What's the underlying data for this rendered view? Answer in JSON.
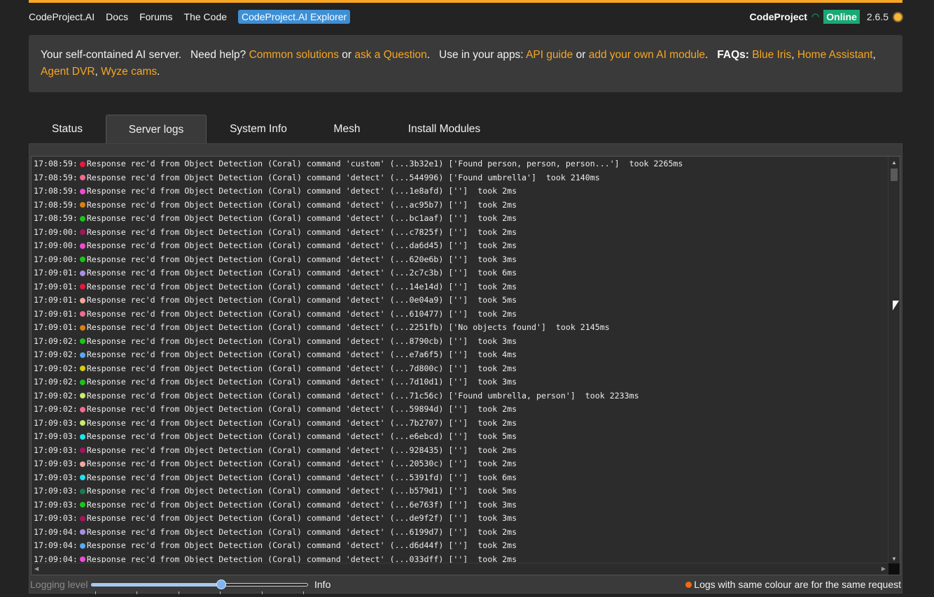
{
  "nav": {
    "items": [
      "CodeProject.AI",
      "Docs",
      "Forums",
      "The Code"
    ],
    "explorer": "CodeProject.AI Explorer"
  },
  "brand": {
    "name": "CodeProject",
    "status": "Online",
    "version": "2.6.5",
    "status_color": "#19a974",
    "accent": "#f6a623"
  },
  "banner": {
    "t1": "Your self-contained AI server.",
    "t2": "Need help?",
    "link_solutions": "Common solutions",
    "or1": "or",
    "link_ask": "ask a Question",
    "t3": "Use in your apps:",
    "link_api": "API guide",
    "or2": "or",
    "link_module": "add your own AI module",
    "faqs": "FAQs:",
    "link_blueiris": "Blue Iris",
    "link_ha": "Home Assistant",
    "link_agent": "Agent DVR",
    "link_wyze": "Wyze cams"
  },
  "tabs": [
    "Status",
    "Server logs",
    "System Info",
    "Mesh",
    "Install Modules"
  ],
  "active_tab": "Server logs",
  "logs": [
    {
      "time": "17:08:59:",
      "color": "#e8173f",
      "text": "Response rec'd from Object Detection (Coral) command 'custom' (...3b32e1) ['Found person, person, person...']  took 2265ms"
    },
    {
      "time": "17:08:59:",
      "color": "#f26a8d",
      "text": "Response rec'd from Object Detection (Coral) command 'detect' (...544996) ['Found umbrella']  took 2140ms"
    },
    {
      "time": "17:08:59:",
      "color": "#ee4bd4",
      "text": "Response rec'd from Object Detection (Coral) command 'detect' (...1e8afd) ['']  took 2ms"
    },
    {
      "time": "17:08:59:",
      "color": "#d9800f",
      "text": "Response rec'd from Object Detection (Coral) command 'detect' (...ac95b7) ['']  took 2ms"
    },
    {
      "time": "17:08:59:",
      "color": "#1bc41b",
      "text": "Response rec'd from Object Detection (Coral) command 'detect' (...bc1aaf) ['']  took 2ms"
    },
    {
      "time": "17:09:00:",
      "color": "#a3165c",
      "text": "Response rec'd from Object Detection (Coral) command 'detect' (...c7825f) ['']  took 2ms"
    },
    {
      "time": "17:09:00:",
      "color": "#ee4bd4",
      "text": "Response rec'd from Object Detection (Coral) command 'detect' (...da6d45) ['']  took 2ms"
    },
    {
      "time": "17:09:00:",
      "color": "#1bc41b",
      "text": "Response rec'd from Object Detection (Coral) command 'detect' (...620e6b) ['']  took 3ms"
    },
    {
      "time": "17:09:01:",
      "color": "#a98ee6",
      "text": "Response rec'd from Object Detection (Coral) command 'detect' (...2c7c3b) ['']  took 6ms"
    },
    {
      "time": "17:09:01:",
      "color": "#e8173f",
      "text": "Response rec'd from Object Detection (Coral) command 'detect' (...14e14d) ['']  took 2ms"
    },
    {
      "time": "17:09:01:",
      "color": "#f0a79a",
      "text": "Response rec'd from Object Detection (Coral) command 'detect' (...0e04a9) ['']  took 5ms"
    },
    {
      "time": "17:09:01:",
      "color": "#f26a8d",
      "text": "Response rec'd from Object Detection (Coral) command 'detect' (...610477) ['']  took 2ms"
    },
    {
      "time": "17:09:01:",
      "color": "#d9800f",
      "text": "Response rec'd from Object Detection (Coral) command 'detect' (...2251fb) ['No objects found']  took 2145ms"
    },
    {
      "time": "17:09:02:",
      "color": "#1bc41b",
      "text": "Response rec'd from Object Detection (Coral) command 'detect' (...8790cb) ['']  took 3ms"
    },
    {
      "time": "17:09:02:",
      "color": "#57a9f2",
      "text": "Response rec'd from Object Detection (Coral) command 'detect' (...e7a6f5) ['']  took 4ms"
    },
    {
      "time": "17:09:02:",
      "color": "#d8cc10",
      "text": "Response rec'd from Object Detection (Coral) command 'detect' (...7d800c) ['']  took 2ms"
    },
    {
      "time": "17:09:02:",
      "color": "#1bc41b",
      "text": "Response rec'd from Object Detection (Coral) command 'detect' (...7d10d1) ['']  took 3ms"
    },
    {
      "time": "17:09:02:",
      "color": "#c8ea6e",
      "text": "Response rec'd from Object Detection (Coral) command 'detect' (...71c56c) ['Found umbrella, person']  took 2233ms"
    },
    {
      "time": "17:09:02:",
      "color": "#f26a8d",
      "text": "Response rec'd from Object Detection (Coral) command 'detect' (...59894d) ['']  took 2ms"
    },
    {
      "time": "17:09:03:",
      "color": "#c8ea6e",
      "text": "Response rec'd from Object Detection (Coral) command 'detect' (...7b2707) ['']  took 2ms"
    },
    {
      "time": "17:09:03:",
      "color": "#22e1f0",
      "text": "Response rec'd from Object Detection (Coral) command 'detect' (...e6ebcd) ['']  took 5ms"
    },
    {
      "time": "17:09:03:",
      "color": "#a3165c",
      "text": "Response rec'd from Object Detection (Coral) command 'detect' (...928435) ['']  took 2ms"
    },
    {
      "time": "17:09:03:",
      "color": "#f0a79a",
      "text": "Response rec'd from Object Detection (Coral) command 'detect' (...20530c) ['']  took 2ms"
    },
    {
      "time": "17:09:03:",
      "color": "#22e1f0",
      "text": "Response rec'd from Object Detection (Coral) command 'detect' (...5391fd) ['']  took 6ms"
    },
    {
      "time": "17:09:03:",
      "color": "#1a7a52",
      "text": "Response rec'd from Object Detection (Coral) command 'detect' (...b579d1) ['']  took 5ms"
    },
    {
      "time": "17:09:03:",
      "color": "#1bc41b",
      "text": "Response rec'd from Object Detection (Coral) command 'detect' (...6e763f) ['']  took 3ms"
    },
    {
      "time": "17:09:03:",
      "color": "#a3165c",
      "text": "Response rec'd from Object Detection (Coral) command 'detect' (...de9f2f) ['']  took 3ms"
    },
    {
      "time": "17:09:04:",
      "color": "#a98ee6",
      "text": "Response rec'd from Object Detection (Coral) command 'detect' (...6199d7) ['']  took 2ms"
    },
    {
      "time": "17:09:04:",
      "color": "#57a9f2",
      "text": "Response rec'd from Object Detection (Coral) command 'detect' (...d6d44f) ['']  took 2ms"
    },
    {
      "time": "17:09:04:",
      "color": "#ee4bd4",
      "text": "Response rec'd from Object Detection (Coral) command 'detect' (...033dff) ['']  took 2ms"
    }
  ],
  "footer": {
    "logging_label": "Logging level",
    "logging_value": "Info",
    "logging_level_fraction": 0.6,
    "legend": "Logs with same colour are for the same request",
    "legend_color": "#f06a10"
  }
}
